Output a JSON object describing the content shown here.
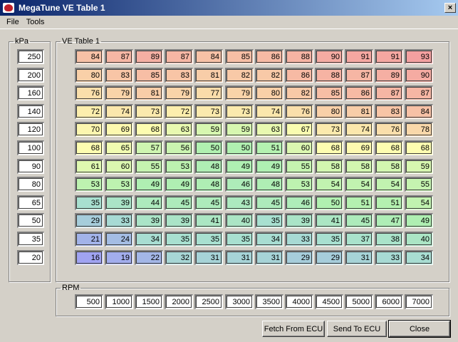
{
  "window": {
    "title": "MegaTune VE Table 1",
    "close_glyph": "×"
  },
  "menu": [
    "File",
    "Tools"
  ],
  "kpa": {
    "label": "kPa",
    "values": [
      "250",
      "200",
      "160",
      "140",
      "120",
      "100",
      "90",
      "80",
      "65",
      "50",
      "35",
      "20"
    ]
  },
  "ve_table": {
    "label": "VE Table 1",
    "rows": [
      [
        "84",
        "87",
        "89",
        "87",
        "84",
        "85",
        "86",
        "88",
        "90",
        "91",
        "91",
        "93"
      ],
      [
        "80",
        "83",
        "85",
        "83",
        "81",
        "82",
        "82",
        "86",
        "88",
        "87",
        "89",
        "90"
      ],
      [
        "76",
        "79",
        "81",
        "79",
        "77",
        "79",
        "80",
        "82",
        "85",
        "86",
        "87",
        "87"
      ],
      [
        "72",
        "74",
        "73",
        "72",
        "73",
        "73",
        "74",
        "76",
        "80",
        "81",
        "83",
        "84"
      ],
      [
        "70",
        "69",
        "68",
        "63",
        "59",
        "59",
        "63",
        "67",
        "73",
        "74",
        "76",
        "78"
      ],
      [
        "68",
        "65",
        "57",
        "56",
        "50",
        "50",
        "51",
        "60",
        "68",
        "69",
        "68",
        "68"
      ],
      [
        "61",
        "60",
        "55",
        "53",
        "48",
        "49",
        "49",
        "55",
        "58",
        "58",
        "58",
        "59"
      ],
      [
        "53",
        "53",
        "49",
        "49",
        "48",
        "46",
        "48",
        "53",
        "54",
        "54",
        "54",
        "55"
      ],
      [
        "35",
        "39",
        "44",
        "45",
        "45",
        "43",
        "45",
        "46",
        "50",
        "51",
        "51",
        "54"
      ],
      [
        "29",
        "33",
        "39",
        "39",
        "41",
        "40",
        "35",
        "39",
        "41",
        "45",
        "47",
        "49"
      ],
      [
        "21",
        "24",
        "34",
        "35",
        "35",
        "35",
        "34",
        "33",
        "35",
        "37",
        "38",
        "40"
      ],
      [
        "16",
        "19",
        "22",
        "32",
        "31",
        "31",
        "31",
        "29",
        "29",
        "31",
        "33",
        "34"
      ]
    ]
  },
  "rpm": {
    "label": "RPM",
    "values": [
      "500",
      "1000",
      "1500",
      "2000",
      "2500",
      "3000",
      "3500",
      "4000",
      "4500",
      "5000",
      "6000",
      "7000"
    ]
  },
  "buttons": {
    "fetch": "Fetch From ECU",
    "send": "Send To ECU",
    "close": "Close"
  },
  "colors": {
    "high": "#f4a0a0",
    "mid": "#fdfdb0",
    "low": "#a0a0f4"
  }
}
